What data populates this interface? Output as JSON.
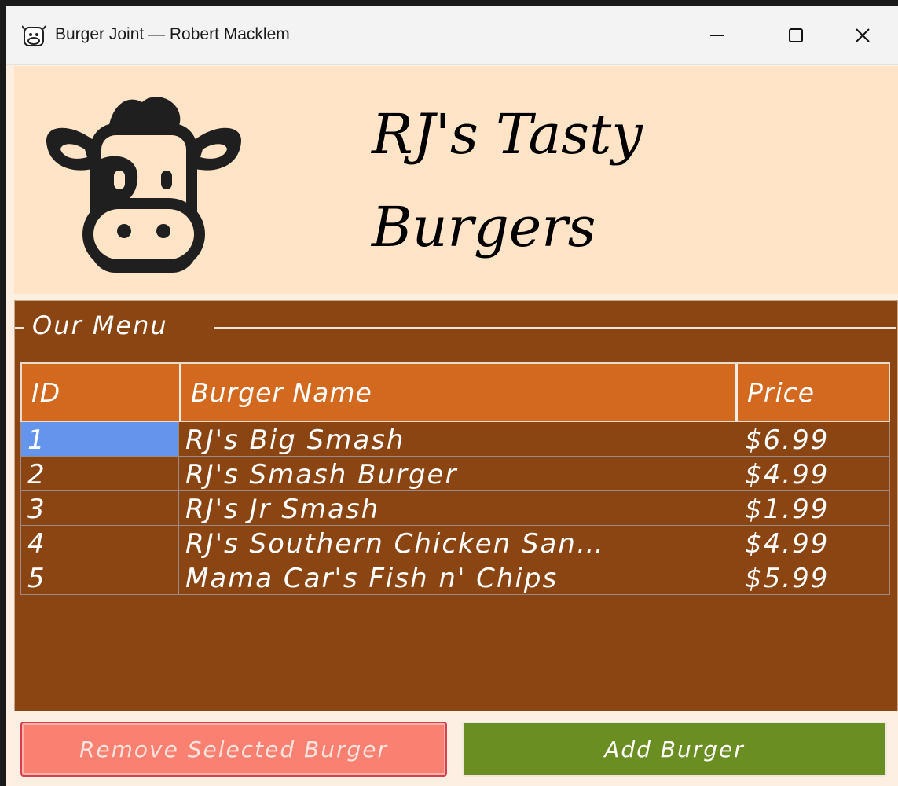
{
  "window": {
    "title": "Burger Joint — Robert Macklem"
  },
  "header": {
    "title_line1": "RJ's Tasty",
    "title_line2": "Burgers",
    "logo_icon": "cow-icon"
  },
  "menu": {
    "group_label": "Our Menu",
    "columns": [
      "ID",
      "Burger Name",
      "Price"
    ],
    "rows": [
      {
        "id": "1",
        "name": "RJ's Big Smash",
        "price": "$6.99"
      },
      {
        "id": "2",
        "name": "RJ's Smash Burger",
        "price": "$4.99"
      },
      {
        "id": "3",
        "name": "RJ's Jr Smash",
        "price": "$1.99"
      },
      {
        "id": "4",
        "name": "RJ's Southern Chicken San…",
        "price": "$4.99"
      },
      {
        "id": "5",
        "name": "Mama Car's Fish n' Chips",
        "price": "$5.99"
      }
    ],
    "selected_row": 0
  },
  "buttons": {
    "remove_label": "Remove Selected Burger",
    "add_label": "Add Burger"
  },
  "colors": {
    "header_bg": "#ffe4c7",
    "panel_bg": "#8b4513",
    "table_header_bg": "#d2691e",
    "selection": "#6495ed",
    "remove_button": "#fa8072",
    "add_button": "#6b8e23"
  }
}
